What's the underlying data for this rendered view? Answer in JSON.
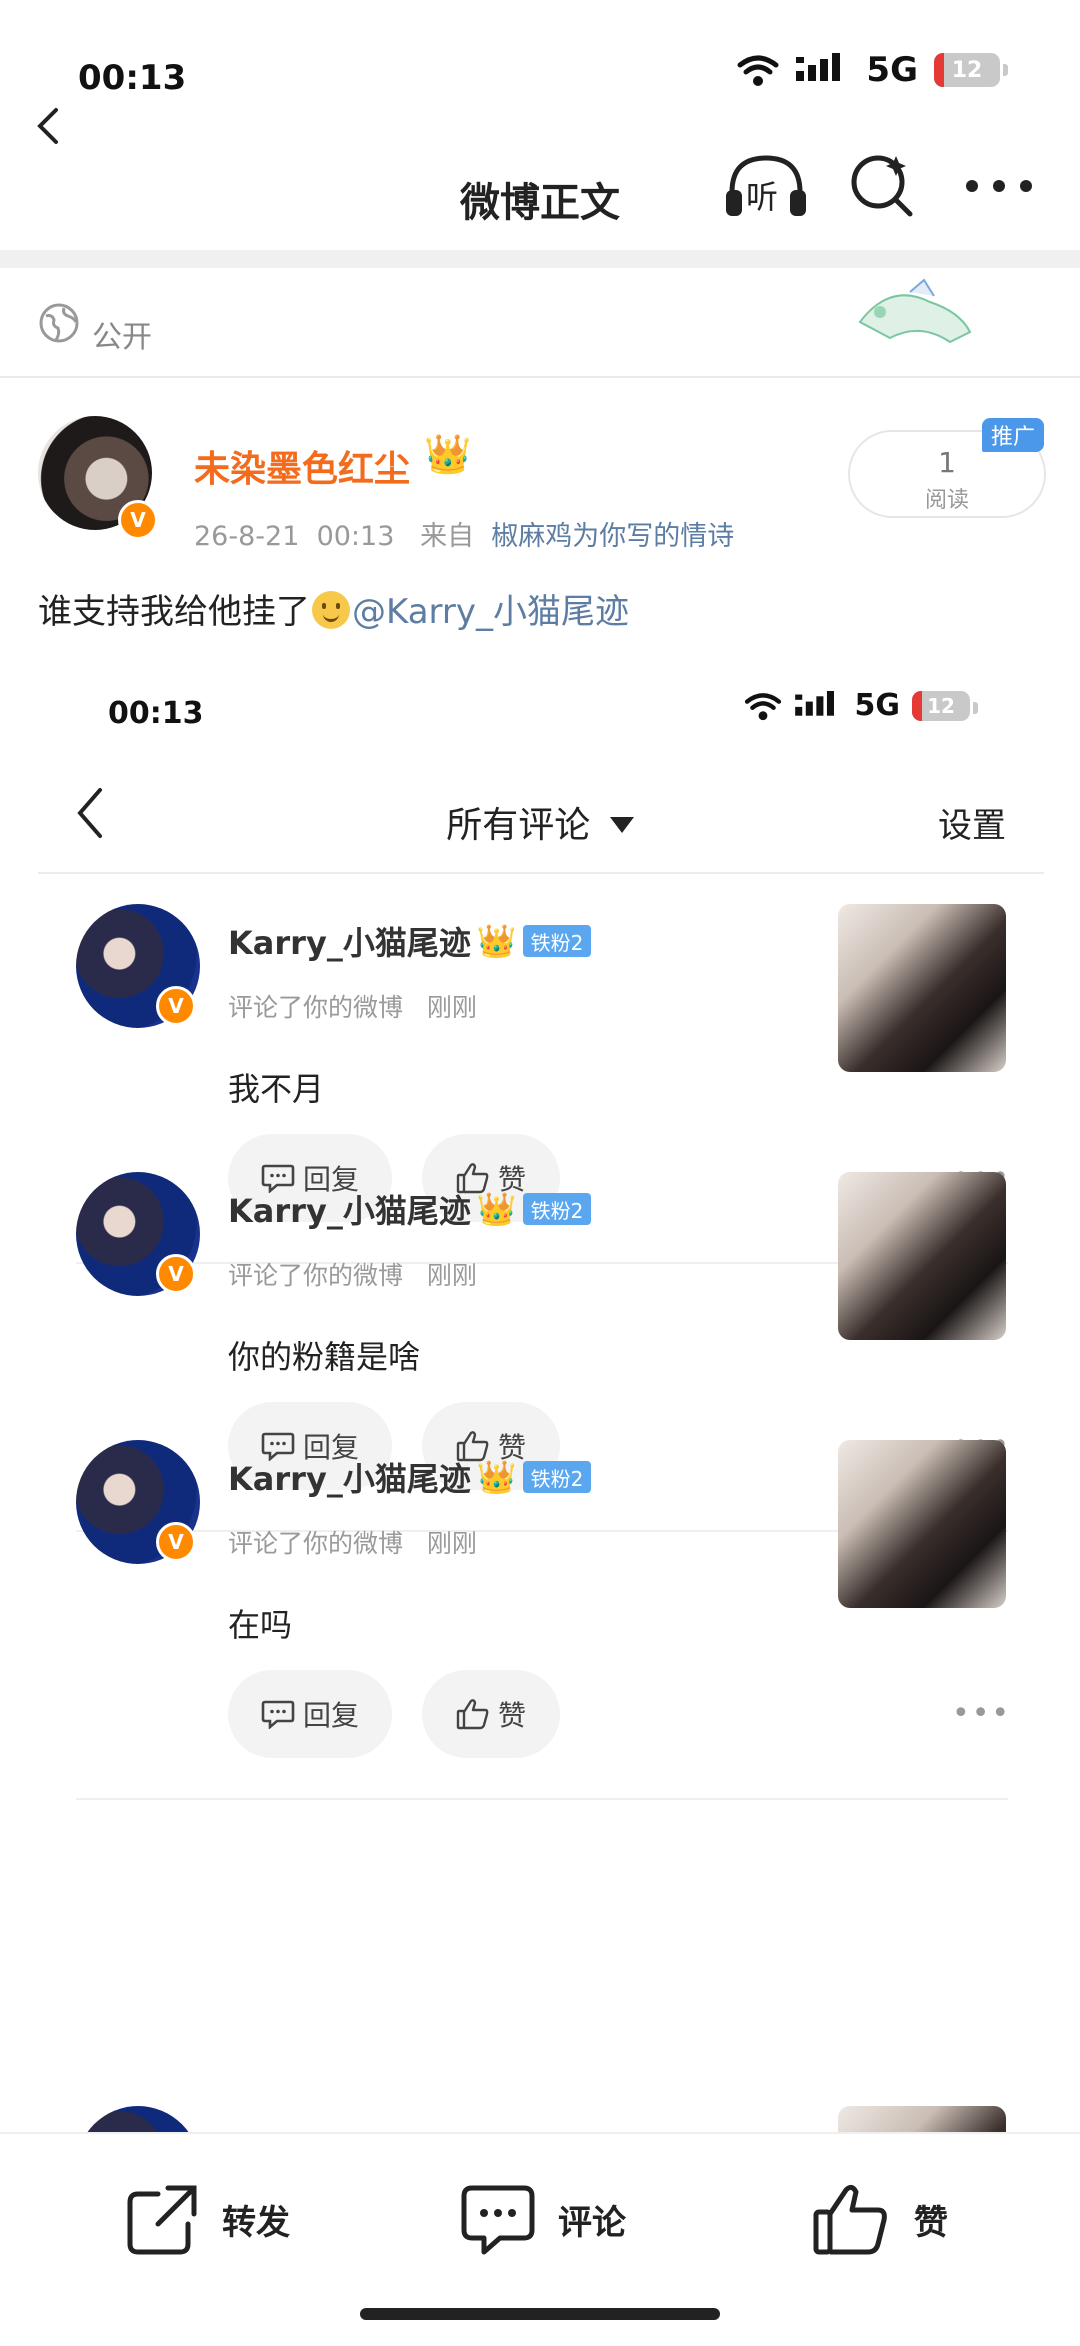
{
  "status_bar": {
    "time": "00:13",
    "network": "5G",
    "battery": "12"
  },
  "nav": {
    "title": "微博正文",
    "listen_label": "听"
  },
  "visibility": {
    "label": "公开"
  },
  "post": {
    "author": "未染墨色红尘",
    "date": "26-8-21",
    "time": "00:13",
    "source_prefix": "来自",
    "source": "椒麻鸡为你写的情诗",
    "read_count": "1",
    "read_label": "阅读",
    "promo_label": "推广",
    "text_before": "谁支持我给他挂了",
    "mention": "@Karry_小猫尾迹"
  },
  "embedded": {
    "status_bar": {
      "time": "00:13",
      "network": "5G",
      "battery": "12"
    },
    "nav_title": "所有评论",
    "settings": "设置",
    "comments": [
      {
        "user": "Karry_小猫尾迹",
        "badge": "铁粉2",
        "action": "评论了你的微博",
        "time": "刚刚",
        "text": "我不月",
        "reply": "回复",
        "like": "赞"
      },
      {
        "user": "Karry_小猫尾迹",
        "badge": "铁粉2",
        "action": "评论了你的微博",
        "time": "刚刚",
        "text": "你的粉籍是啥",
        "reply": "回复",
        "like": "赞"
      },
      {
        "user": "Karry_小猫尾迹",
        "badge": "铁粉2",
        "action": "评论了你的微博",
        "time": "刚刚",
        "text": "在吗",
        "reply": "回复",
        "like": "赞"
      }
    ]
  },
  "toolbar": {
    "repost": "转发",
    "comment": "评论",
    "like": "赞"
  },
  "colors": {
    "username": "#f36b1c",
    "link": "#5d7da3",
    "vip_badge": "#ff8a00",
    "fan_badge": "#5aa7f0"
  }
}
